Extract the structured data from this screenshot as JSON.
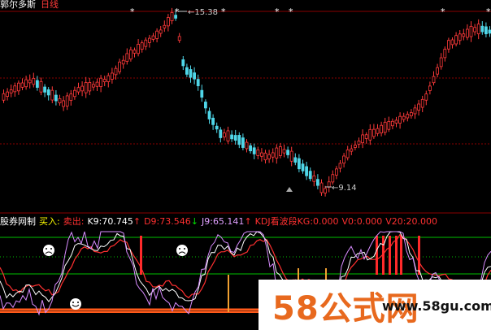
{
  "header": {
    "stock_name": "郭尔多斯",
    "period": "日线"
  },
  "price_chart": {
    "high_label": "15.38",
    "low_label": "9.14",
    "markers": [
      "*",
      "*",
      "*",
      "*",
      "*",
      "*",
      "*",
      "*"
    ]
  },
  "indicator_header": {
    "name": "股券网制",
    "buy": "买入:",
    "sell": "卖出:",
    "k9_label": "K9:",
    "k9_value": "70.745",
    "k9_arrow": "↑",
    "d9_label": "D9:",
    "d9_value": "73.546",
    "d9_arrow": "↓",
    "j9_label": "J9:",
    "j9_value": "65.141",
    "j9_arrow": "↑",
    "kdj_label": "KDJ看波段KG:",
    "kg_value": "0.000",
    "v0_label": "V0:",
    "v0_value": "0.000",
    "v20_label": "V20:",
    "v20_value": "20.000"
  },
  "watermark": {
    "brand_58": "58",
    "brand_text": "公式网",
    "url": "www.58gu.com"
  },
  "colors": {
    "background": "#000000",
    "up_candle": "#ff3a3a",
    "down_candle": "#4fd6e8",
    "grid_red": "#8a0000",
    "grid_green": "#00c000",
    "k_line": "#ffffff",
    "d_line": "#ff3030",
    "j_line": "#d88cff",
    "sell_bar": "#ff2a2a",
    "buy_bar": "#f0a030",
    "watermark_orange": "#e8691e"
  }
}
